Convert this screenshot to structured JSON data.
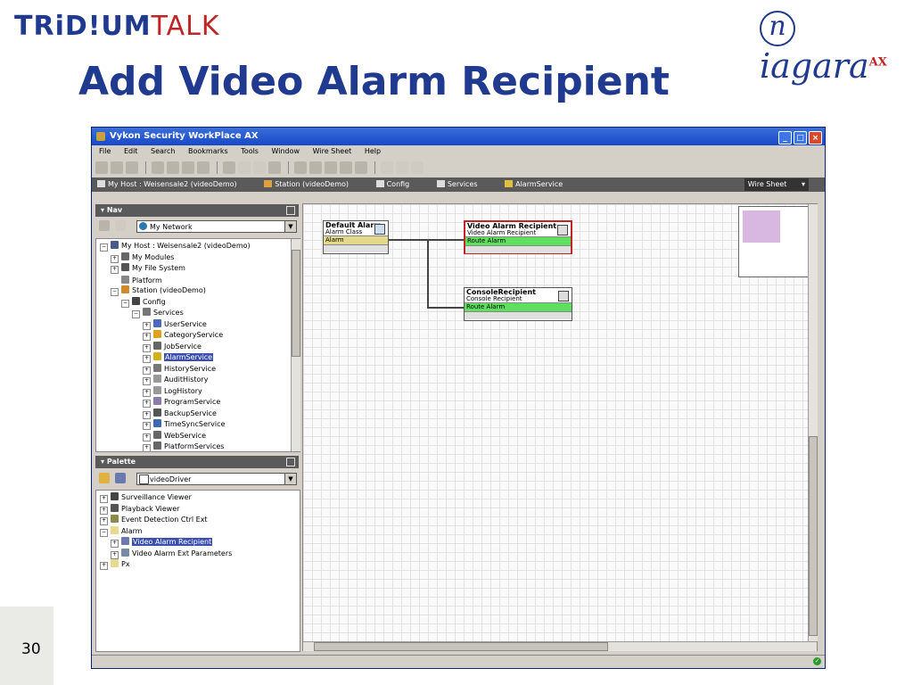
{
  "slide": {
    "logo_left_a": "TRiD!UM",
    "logo_left_b": "TALK",
    "logo_right": "iagara",
    "logo_right_n": "n",
    "logo_right_sup": "AX",
    "title": "Add Video Alarm Recipient",
    "page_number": "30"
  },
  "window": {
    "title": "Vykon Security WorkPlace AX",
    "menu": [
      "File",
      "Edit",
      "Search",
      "Bookmarks",
      "Tools",
      "Window",
      "Wire Sheet",
      "Help"
    ],
    "breadcrumbs": [
      "My Host : Weisensale2 (videoDemo)",
      "Station (videoDemo)",
      "Config",
      "Services",
      "AlarmService"
    ],
    "view_selector": "Wire Sheet"
  },
  "nav": {
    "header": "Nav",
    "combo_value": "My Network",
    "tree": [
      {
        "label": "My Host : Weisensale2 (videoDemo)",
        "level": 0,
        "exp": "−",
        "color": "#4a5a8a"
      },
      {
        "label": "My Modules",
        "level": 1,
        "exp": "+",
        "color": "#666666"
      },
      {
        "label": "My File System",
        "level": 1,
        "exp": "+",
        "color": "#555555"
      },
      {
        "label": "Platform",
        "level": 1,
        "exp": "",
        "color": "#888888"
      },
      {
        "label": "Station (videoDemo)",
        "level": 1,
        "exp": "−",
        "color": "#d08a2a"
      },
      {
        "label": "Config",
        "level": 2,
        "exp": "−",
        "color": "#444444"
      },
      {
        "label": "Services",
        "level": 3,
        "exp": "−",
        "color": "#777777"
      },
      {
        "label": "UserService",
        "level": 4,
        "exp": "+",
        "color": "#4a6ac0"
      },
      {
        "label": "CategoryService",
        "level": 4,
        "exp": "+",
        "color": "#e0a020"
      },
      {
        "label": "JobService",
        "level": 4,
        "exp": "+",
        "color": "#666666"
      },
      {
        "label": "AlarmService",
        "level": 4,
        "exp": "+",
        "color": "#d4b020",
        "selected": true
      },
      {
        "label": "HistoryService",
        "level": 4,
        "exp": "+",
        "color": "#777777"
      },
      {
        "label": "AuditHistory",
        "level": 4,
        "exp": "+",
        "color": "#999999"
      },
      {
        "label": "LogHistory",
        "level": 4,
        "exp": "+",
        "color": "#999999"
      },
      {
        "label": "ProgramService",
        "level": 4,
        "exp": "+",
        "color": "#8a7ab0"
      },
      {
        "label": "BackupService",
        "level": 4,
        "exp": "+",
        "color": "#555555"
      },
      {
        "label": "TimeSyncService",
        "level": 4,
        "exp": "+",
        "color": "#3a6ab0"
      },
      {
        "label": "WebService",
        "level": 4,
        "exp": "+",
        "color": "#666666"
      },
      {
        "label": "PlatformServices",
        "level": 4,
        "exp": "+",
        "color": "#666666"
      }
    ]
  },
  "palette": {
    "header": "Palette",
    "combo_value": "videoDriver",
    "tree": [
      {
        "label": "Surveillance Viewer",
        "level": 0,
        "exp": "+",
        "color": "#444444"
      },
      {
        "label": "Playback Viewer",
        "level": 0,
        "exp": "+",
        "color": "#555555"
      },
      {
        "label": "Event Detection Ctrl Ext",
        "level": 0,
        "exp": "+",
        "color": "#8a8a4a"
      },
      {
        "label": "Alarm",
        "level": 0,
        "exp": "−",
        "color": "#e8d890"
      },
      {
        "label": "Video Alarm Recipient",
        "level": 1,
        "exp": "+",
        "color": "#6a7ab0",
        "selected": true
      },
      {
        "label": "Video Alarm Ext Parameters",
        "level": 1,
        "exp": "+",
        "color": "#7a8aa0"
      },
      {
        "label": "Px",
        "level": 0,
        "exp": "+",
        "color": "#e8d890"
      }
    ]
  },
  "wiresheet": {
    "nodes": [
      {
        "id": "default-alarm",
        "title": "Default Alarm",
        "subtitle": "Alarm Class",
        "slot": "Alarm",
        "slot_color": "#e4d88a",
        "border": "#555555"
      },
      {
        "id": "video-alarm-recipient",
        "title": "Video Alarm Recipient",
        "subtitle": "Video Alarm Recipient",
        "slot": "Route Alarm",
        "slot_color": "#5ee05e",
        "border": "#c02424"
      },
      {
        "id": "console-recipient",
        "title": "ConsoleRecipient",
        "subtitle": "Console Recipient",
        "slot": "Route Alarm",
        "slot_color": "#5ee05e",
        "border": "#555555"
      }
    ],
    "links": [
      {
        "from": "default-alarm",
        "to": "video-alarm-recipient"
      },
      {
        "from": "default-alarm",
        "to": "console-recipient"
      }
    ]
  }
}
